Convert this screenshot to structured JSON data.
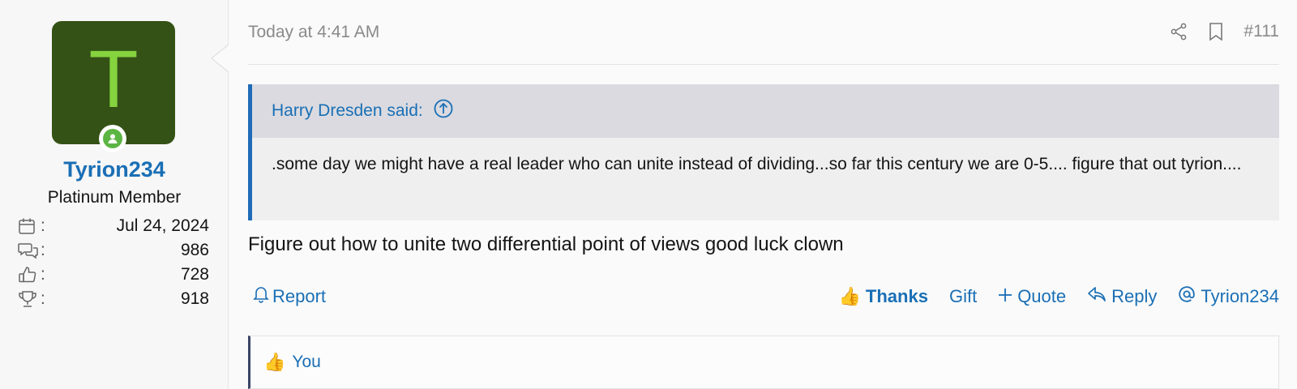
{
  "user": {
    "avatar_letter": "T",
    "username": "Tyrion234",
    "title": "Platinum Member",
    "stats": [
      {
        "icon": "calendar-icon",
        "value": "Jul 24, 2024"
      },
      {
        "icon": "messages-icon",
        "value": "986"
      },
      {
        "icon": "reaction-score-icon",
        "value": "728"
      },
      {
        "icon": "trophy-icon",
        "value": "918"
      }
    ],
    "stat_colon": ":"
  },
  "post": {
    "timestamp": "Today at 4:41 AM",
    "post_number": "#111",
    "quote": {
      "author": "Harry Dresden said:",
      "text": ".some day we might have a real leader who can unite instead of dividing...so far this century we are 0-5.... figure that out tyrion...."
    },
    "message": "Figure out how to unite two differential point of views good luck clown"
  },
  "actions": {
    "report": "Report",
    "thanks": "Thanks",
    "gift": "Gift",
    "quote": "Quote",
    "reply": "Reply",
    "mention": "Tyrion234"
  },
  "reactions": {
    "label": "You"
  },
  "colors": {
    "accent": "#1a6fb5",
    "avatar_bg": "#345215",
    "avatar_fg": "#85d33e",
    "online": "#5bb543",
    "quote_bar": "#1f6bb8"
  }
}
